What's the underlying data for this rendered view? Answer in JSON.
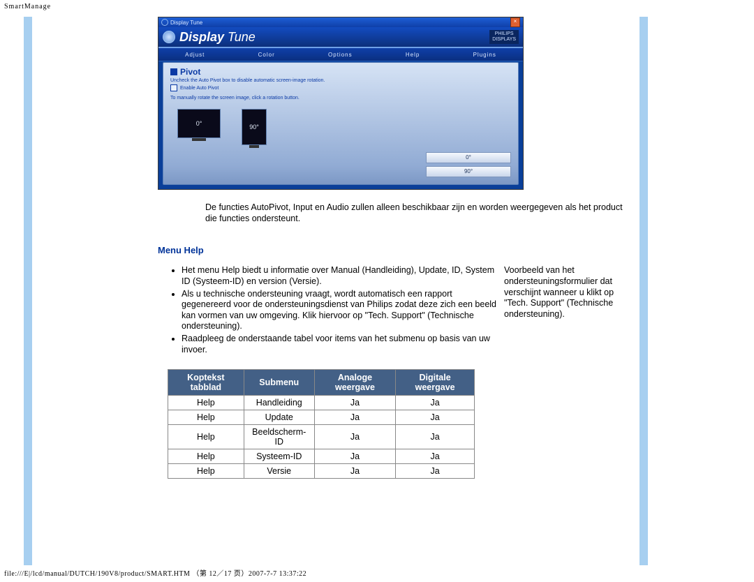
{
  "page": {
    "header": "SmartManage",
    "footer": "file:///E|/lcd/manual/DUTCH/190V8/product/SMART.HTM （第 12／17 页）2007-7-7 13:37:22"
  },
  "screenshot": {
    "window_title": "Display Tune",
    "brand_1": "Display",
    "brand_2": "Tune",
    "model_line1": "PHILIPS",
    "model_line2": "DISPLAYS",
    "tabs": [
      "Adjust",
      "Color",
      "Options",
      "Help",
      "Plugins"
    ],
    "panel_title": "Pivot",
    "panel_sub": "Uncheck the Auto Pivot box to disable automatic screen-image rotation.",
    "checkbox_label": "Enable Auto Pivot",
    "panel_note": "To manually rotate the screen image, click a rotation button.",
    "mon_l": "0°",
    "mon_p": "90°",
    "btn_0": "0°",
    "btn_90": "90°"
  },
  "body": {
    "autopivot_note": "De functies AutoPivot, Input en Audio zullen alleen beschikbaar zijn en worden weergegeven als het product die functies ondersteunt.",
    "section_title": "Menu Help",
    "bullets": [
      "Het menu Help biedt u informatie over Manual (Handleiding), Update, ID, System ID (Systeem-ID) en version (Versie).",
      "Als u technische ondersteuning vraagt, wordt automatisch een rapport gegenereerd voor de ondersteuningsdienst van Philips zodat deze zich een beeld kan vormen van uw omgeving. Klik hiervoor op \"Tech. Support\" (Technische ondersteuning).",
      "Raadpleeg de onderstaande tabel voor items van het submenu op basis van uw invoer."
    ],
    "side_note": "Voorbeeld van het ondersteuningsformulier dat verschijnt wanneer u klikt op \"Tech. Support\" (Technische ondersteuning)."
  },
  "table": {
    "headers": [
      "Koptekst tabblad",
      "Submenu",
      "Analoge weergave",
      "Digitale weergave"
    ],
    "rows": [
      [
        "Help",
        "Handleiding",
        "Ja",
        "Ja"
      ],
      [
        "Help",
        "Update",
        "Ja",
        "Ja"
      ],
      [
        "Help",
        "Beeldscherm-ID",
        "Ja",
        "Ja"
      ],
      [
        "Help",
        "Systeem-ID",
        "Ja",
        "Ja"
      ],
      [
        "Help",
        "Versie",
        "Ja",
        "Ja"
      ]
    ]
  }
}
